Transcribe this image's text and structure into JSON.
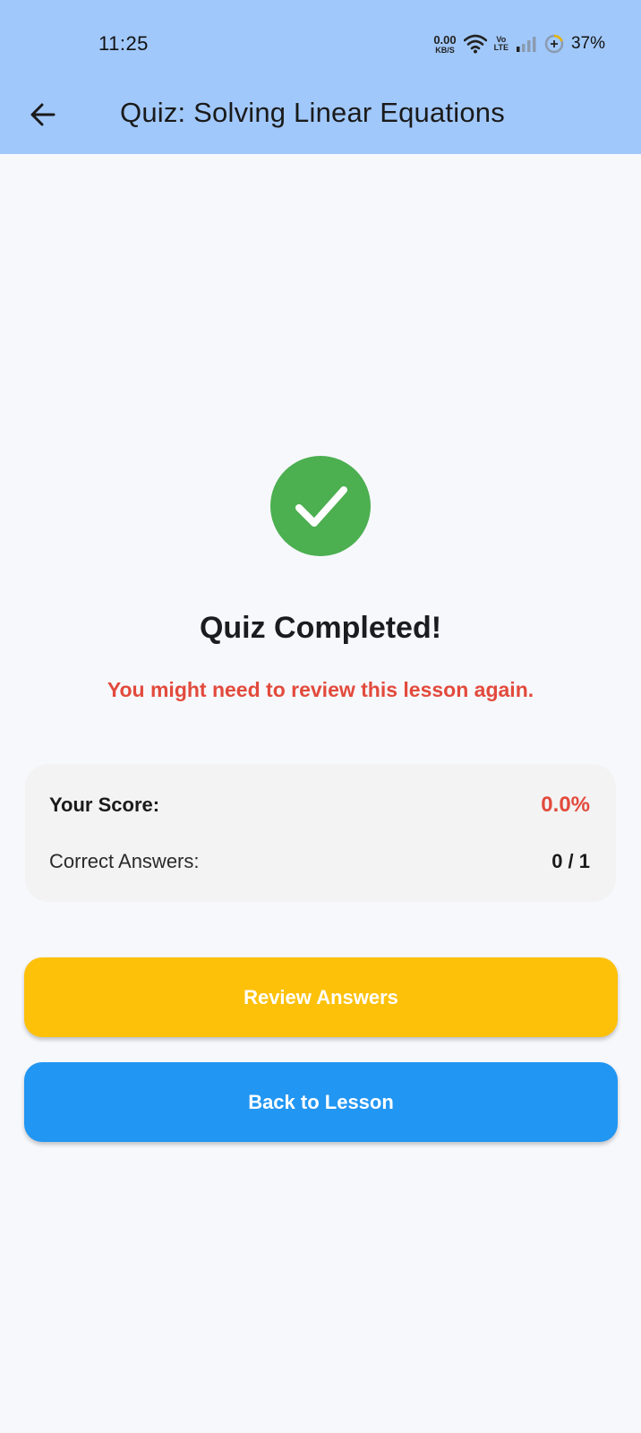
{
  "status_bar": {
    "time": "11:25",
    "net_speed_value": "0.00",
    "net_speed_unit": "KB/S",
    "volte_top": "Vo",
    "volte_bottom": "LTE",
    "battery_percent": "37%",
    "icons": [
      "wifi-icon",
      "signal-icon",
      "battery-saver-icon"
    ]
  },
  "toolbar": {
    "back_icon": "arrow-left-icon",
    "title": "Quiz: Solving Linear Equations"
  },
  "result": {
    "icon": "check-circle-icon",
    "headline": "Quiz Completed!",
    "feedback": "You might need to review this lesson again."
  },
  "score_card": {
    "score_label": "Your Score:",
    "score_value": "0.0%",
    "correct_label": "Correct Answers:",
    "correct_value": "0 / 1"
  },
  "actions": {
    "review_label": "Review Answers",
    "back_label": "Back to Lesson"
  },
  "colors": {
    "header_bg": "#a1c8fb",
    "page_bg": "#f7f8fc",
    "success_green": "#4caf50",
    "error_red": "#e24a3c",
    "review_button": "#fdc10a",
    "back_button": "#2196f3",
    "card_bg": "#f3f3f3"
  }
}
